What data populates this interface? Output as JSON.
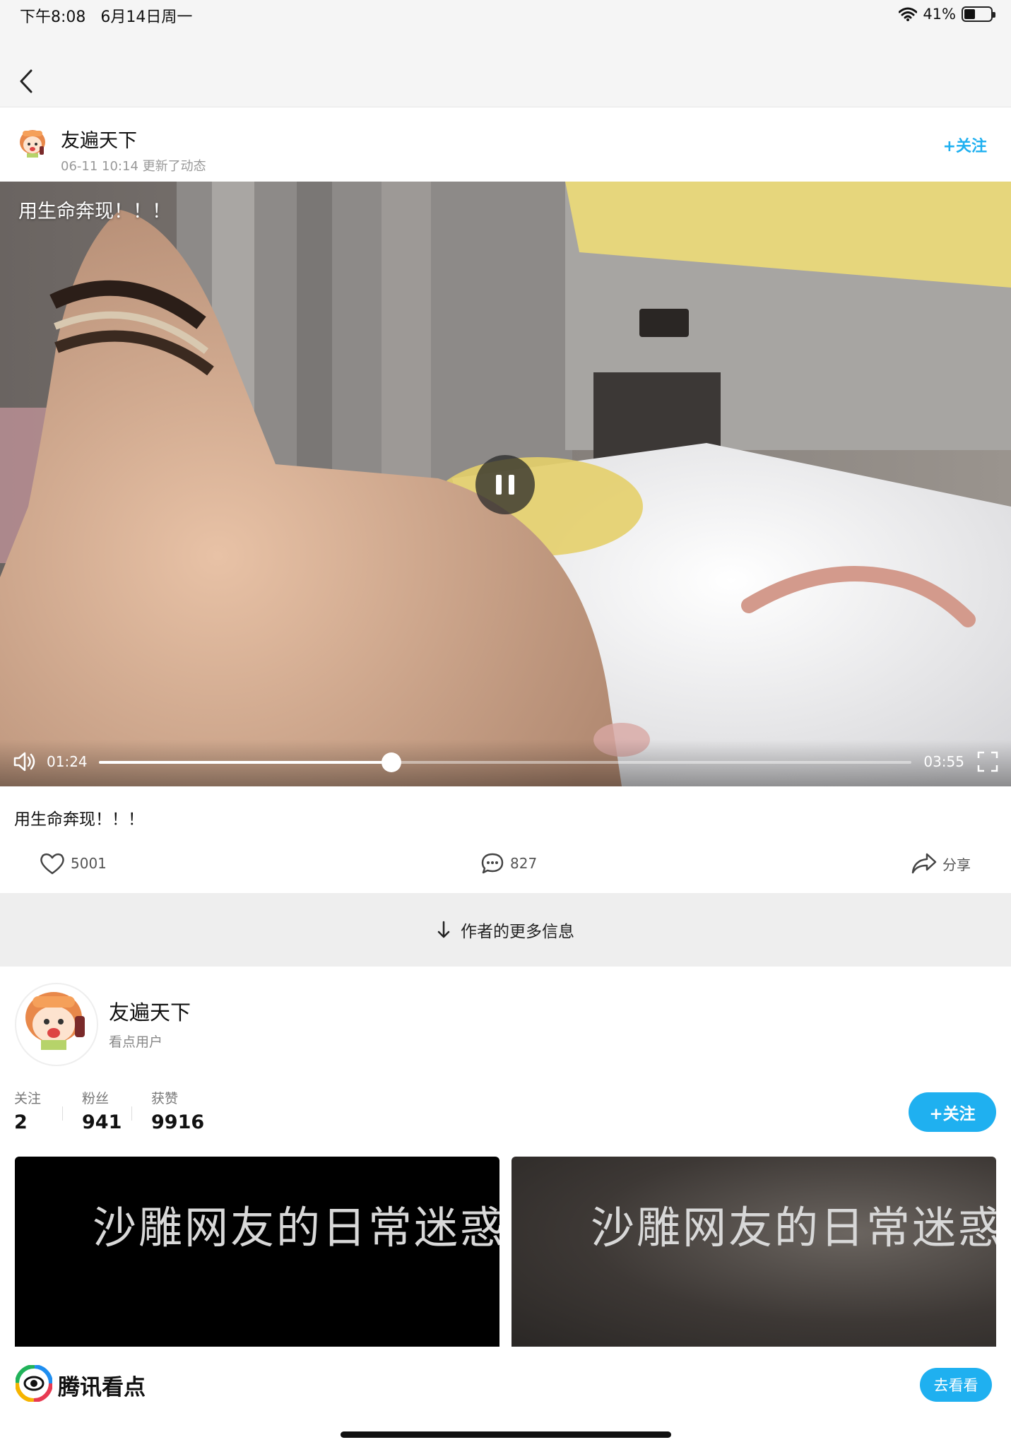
{
  "status_bar": {
    "time": "下午8:08",
    "date": "6月14日周一",
    "battery_text": "41%",
    "battery_level": 0.41
  },
  "post_header": {
    "author_name": "友遍天下",
    "meta": "06-11 10:14 更新了动态",
    "follow_label": "+关注"
  },
  "video": {
    "overlay_caption": "用生命奔现！！！",
    "current_time": "01:24",
    "duration": "03:55",
    "progress": 0.36
  },
  "post": {
    "text": "用生命奔现！！！",
    "likes": "5001",
    "comments": "827",
    "share_label": "分享"
  },
  "more_info": {
    "label": "作者的更多信息"
  },
  "profile": {
    "name": "友遍天下",
    "type": "看点用户",
    "stats": [
      {
        "label": "关注",
        "value": "2"
      },
      {
        "label": "粉丝",
        "value": "941"
      },
      {
        "label": "获赞",
        "value": "9916"
      }
    ],
    "follow_label": "+关注"
  },
  "thumbnails": [
    {
      "title": "沙雕网友的日常迷惑"
    },
    {
      "title": "沙雕网友的日常迷惑"
    }
  ],
  "banner": {
    "app_name": "腾讯看点",
    "cta": "去看看"
  },
  "colors": {
    "accent": "#1fb0f0",
    "band": "#eeeeee"
  }
}
